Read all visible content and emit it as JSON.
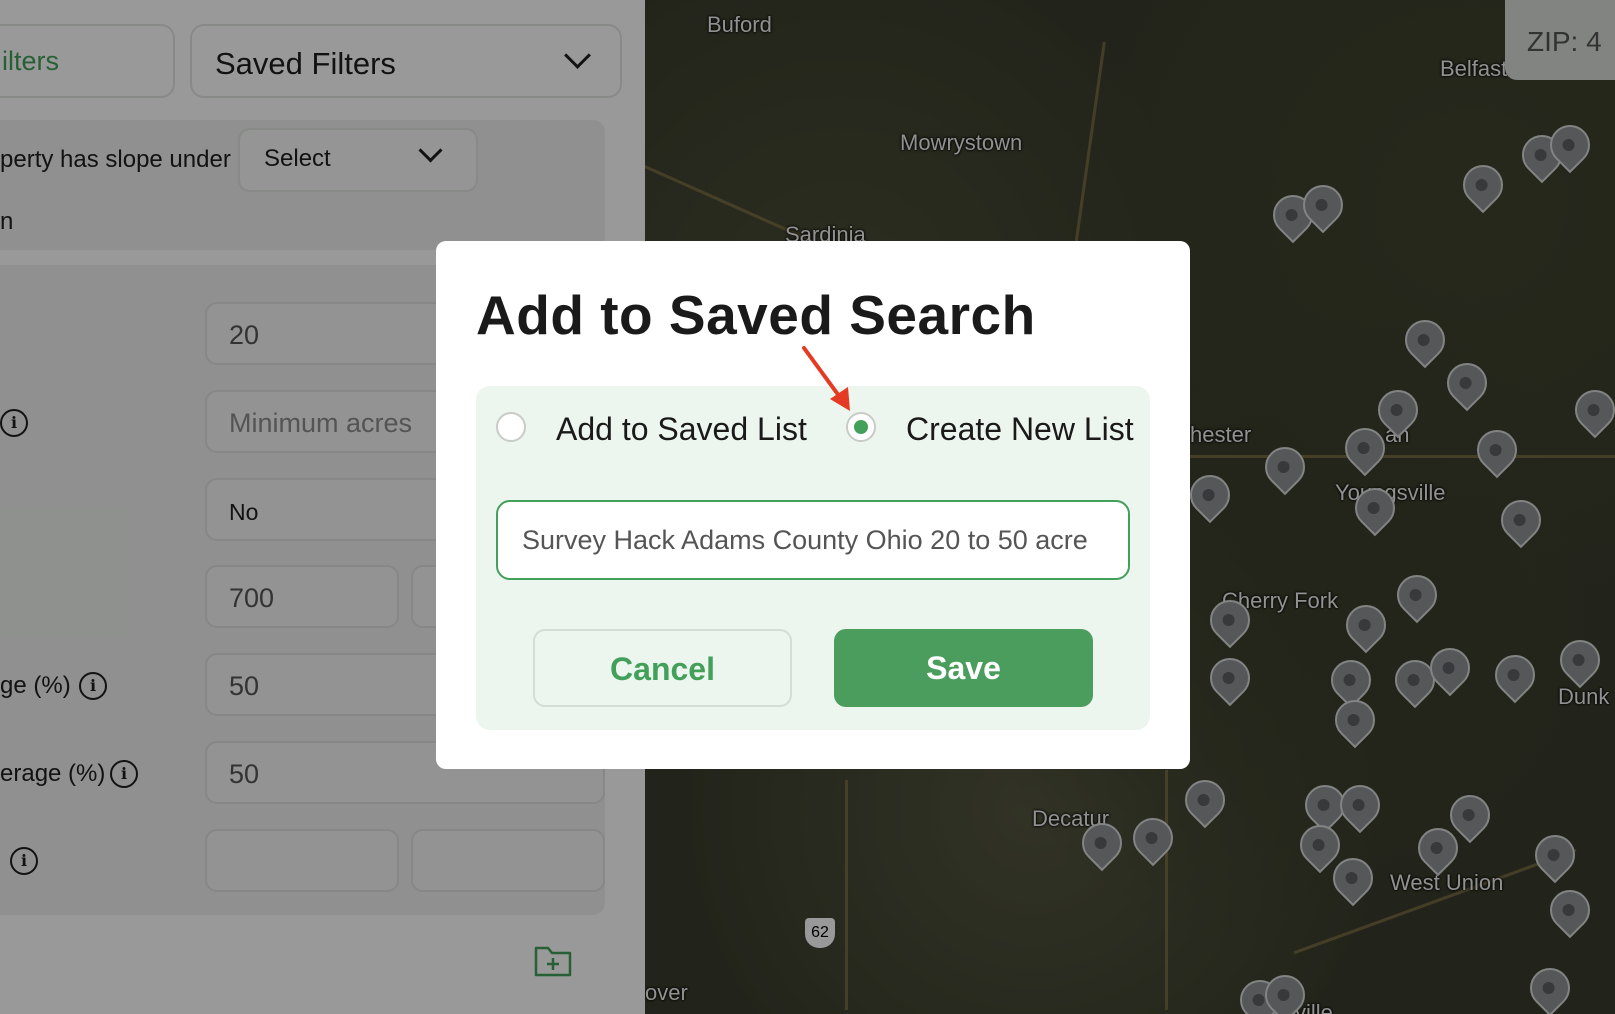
{
  "left_panel": {
    "tab_filters": "ilters",
    "saved_filters": "Saved Filters",
    "slope_label": "perty has slope under",
    "slope_select": "Select",
    "row_n": "n",
    "inputs": {
      "row1_value": "20",
      "min_acres_placeholder": "Minimum acres",
      "row3_value": "No",
      "row4_value": "700",
      "row5_value": "50",
      "row6_value": "50"
    },
    "labels": {
      "pct_label_1": "ge (%)",
      "pct_label_2": "erage (%)"
    }
  },
  "map": {
    "zip_label": "ZIP: 4",
    "towns": [
      "Buford",
      "Mowrystown",
      "Sardinia",
      "Belfast",
      "hester",
      "an",
      "Youngsville",
      "Cherry Fork",
      "Dunk",
      "Decatur",
      "West Union",
      "over",
      "ville"
    ],
    "route_shield": "62"
  },
  "modal": {
    "title": "Add to Saved Search",
    "option_saved": "Add to Saved List",
    "option_new": "Create New List",
    "selected_option": "Create New List",
    "list_name_value": "Survey Hack Adams County Ohio 20 to 50 acre",
    "cancel_label": "Cancel",
    "save_label": "Save"
  },
  "colors": {
    "accent_green": "#43a05a",
    "annotation_arrow": "#e53a24"
  },
  "icons": [
    "chevron-down-icon",
    "info-icon",
    "add-folder-icon",
    "map-pin-icon",
    "arrow-annotation-icon"
  ]
}
